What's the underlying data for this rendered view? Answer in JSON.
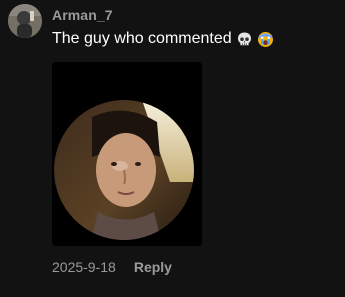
{
  "comment": {
    "username": "Arman_7",
    "text": "The guy who commented",
    "emojis": [
      "skull-emoji",
      "crying-face-emoji"
    ],
    "date": "2025-9-18",
    "reply_label": "Reply"
  },
  "colors": {
    "background": "#121212",
    "username": "#9a9a9a",
    "text": "#ffffff",
    "meta": "#9a9a9a"
  }
}
